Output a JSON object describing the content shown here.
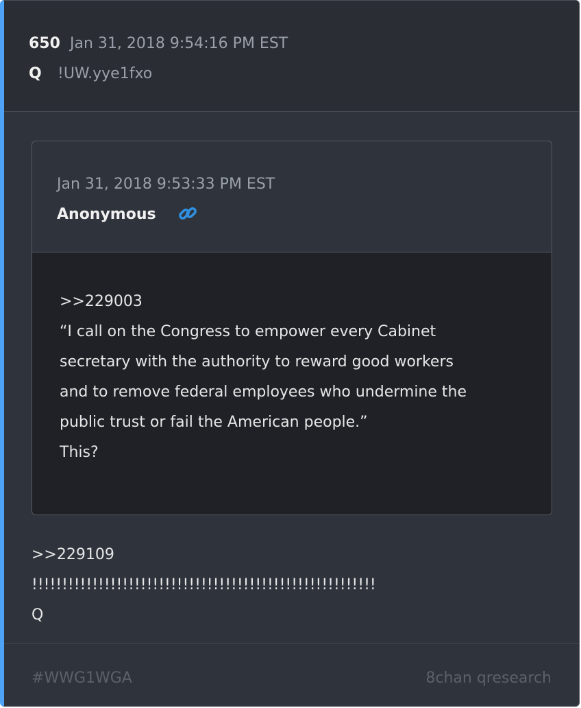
{
  "post": {
    "number": "650",
    "date": "Jan 31, 2018 9:54:16 PM EST",
    "author": "Q",
    "tripcode": "!UW.yye1fxo"
  },
  "quoted_post": {
    "date": "Jan 31, 2018 9:53:33 PM EST",
    "author": "Anonymous",
    "link_icon": "link-icon",
    "body_lines": [
      ">>229003",
      "“I call on the Congress to empower every Cabinet",
      "secretary with the authority to reward good workers",
      "and to remove federal employees who undermine the",
      "public trust or fail the American people.”",
      "",
      "This?"
    ]
  },
  "body_lines": [
    ">>229109",
    "!!!!!!!!!!!!!!!!!!!!!!!!!!!!!!!!!!!!!!!!!!!!!!!!!!!!!!!!!",
    "Q"
  ],
  "footer": {
    "tag": "#WWG1WGA",
    "source": "8chan qresearch"
  },
  "colors": {
    "accent": "#4fa3f7",
    "link": "#2f8fe0"
  }
}
